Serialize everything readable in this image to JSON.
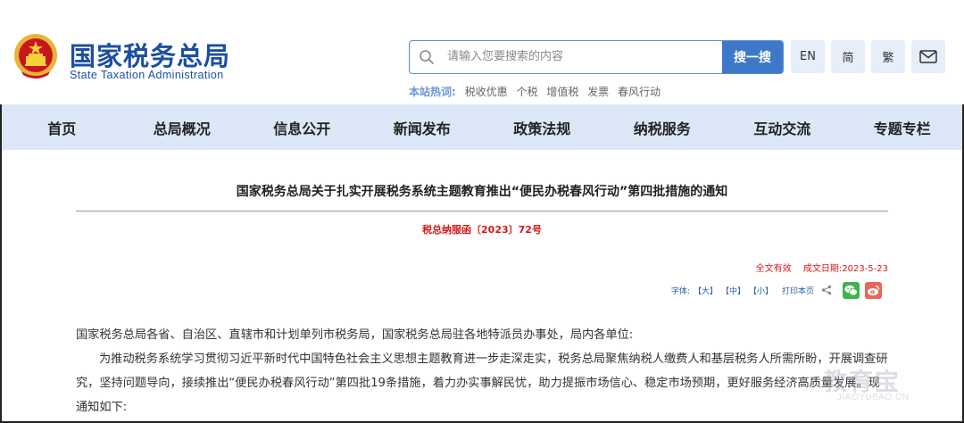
{
  "header": {
    "logo_cn": "国家税务总局",
    "logo_en": "State Taxation Administration"
  },
  "search": {
    "placeholder": "请输入您要搜索的内容",
    "button": "搜一搜"
  },
  "utilities": {
    "english": "EN",
    "simplified": "简",
    "traditional": "繁"
  },
  "hot_search": {
    "label": "本站热词:",
    "items": [
      "税收优惠",
      "个税",
      "增值税",
      "发票",
      "春风行动"
    ]
  },
  "nav": {
    "items": [
      "首页",
      "总局概况",
      "信息公开",
      "新闻发布",
      "政策法规",
      "纳税服务",
      "互动交流",
      "专题专栏"
    ]
  },
  "article": {
    "title": "国家税务总局关于扎实开展税务系统主题教育推出“便民办税春风行动”第四批措施的通知",
    "doc_number": "税总纳服函〔2023〕72号",
    "validity": "全文有效",
    "date_label": "成文日期:",
    "date": "2023-5-23",
    "font_size_label": "字体:",
    "font_large": "【大】",
    "font_medium": "【中】",
    "font_small": "【小】",
    "print": "打印本页",
    "para1": "国家税务总局各省、自治区、直辖市和计划单列市税务局，国家税务总局驻各地特派员办事处，局内各单位:",
    "para2": "为推动税务系统学习贯彻习近平新时代中国特色社会主义思想主题教育进一步走深走实，税务总局聚焦纳税人缴费人和基层税务人所需所盼，开展调查研究，坚持问题导向，接续推出“便民办税春风行动”第四批19条措施，着力办实事解民忧，助力提振市场信心、稳定市场预期，更好服务经济高质量发展。现通知如下:"
  },
  "watermark": {
    "text": "教育宝",
    "url": "JIAOYUBAO.CN"
  },
  "colors": {
    "brand_blue": "#1c4fa0",
    "nav_bg": "#dbe7f7",
    "search_button": "#3d78c9",
    "doc_red": "#d21b1b"
  }
}
